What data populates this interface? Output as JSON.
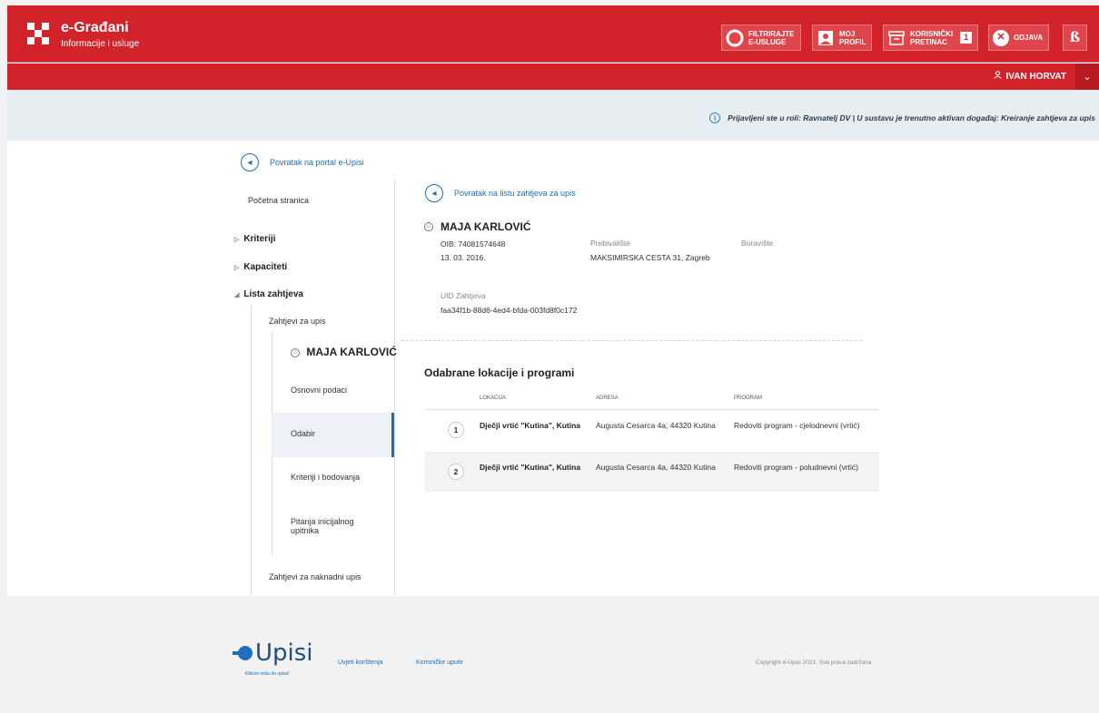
{
  "header": {
    "brand_title": "e-Građani",
    "brand_subtitle": "Informacije i usluge",
    "buttons": {
      "filter_line1": "FILTRIRAJTE",
      "filter_line2": "E-USLUGE",
      "profile_line1": "MOJ",
      "profile_line2": "PROFIL",
      "inbox_line1": "KORISNIČKI",
      "inbox_line2": "PRETINAC",
      "inbox_count": "1",
      "logout": "ODJAVA"
    },
    "user_name": "IVAN HORVAT"
  },
  "info_message": "Prijavljeni ste u roli: Ravnatelj DV | U sustavu je trenutno aktivan događaj: Kreiranje zahtjeva za upis",
  "sidebar": {
    "back_to_portal": "Povratak na portal e-Upisi",
    "home": "Početna stranica",
    "criteria": "Kriteriji",
    "capacities": "Kapaciteti",
    "request_list": "Lista zahtjeva",
    "enrollment_requests": "Zahtjevi za upis",
    "child_name": "MAJA KARLOVIĆ",
    "sub_items": [
      "Osnovni podaci",
      "Odabir",
      "Kriteriji i bodovanja",
      "Pitanja inicijalnog upitnika"
    ],
    "late_requests": "Zahtjevi za naknadni upis"
  },
  "main": {
    "back_to_list": "Povratak na listu zahtjeva za upis",
    "child_name": "MAJA KARLOVIĆ",
    "oib": "OIB: 74081574648",
    "birth_date": "13. 03. 2016.",
    "residence_label": "Prebivalište",
    "residence_value": "MAKSIMIRSKA CESTA 31, Zagreb",
    "stay_label": "Boravište",
    "uid_label": "UID Zahtjeva",
    "uid_value": "faa34f1b-88d6-4ed4-bfda-003fd8f0c172",
    "section_title": "Odabrane lokacije i programi",
    "table": {
      "headers": [
        "LOKACIJA",
        "ADRESA",
        "PROGRAM"
      ],
      "rows": [
        {
          "num": "1",
          "location": "Dječji vrtić \"Kutina\", Kutina",
          "address": "Augusta Cesarca 4a, 44320 Kutina",
          "program": "Redoviti program - cjelodnevni (vrtić)"
        },
        {
          "num": "2",
          "location": "Dječji vrtić \"Kutina\", Kutina",
          "address": "Augusta Cesarca 4a, 44320 Kutina",
          "program": "Redoviti program - poludnevni (vrtić)"
        }
      ]
    }
  },
  "footer": {
    "logo_text": "Upisi",
    "tagline": "Klikom miša do upisa!",
    "terms": "Uvjeti korištenja",
    "guide": "Korisničke upute",
    "copyright": "Copyright e-Upisi 2021. Sva prava zadržana"
  },
  "colors": {
    "brand_red": "#d2232a",
    "link_blue": "#1c6fb6",
    "info_bg": "#e7eef1"
  }
}
